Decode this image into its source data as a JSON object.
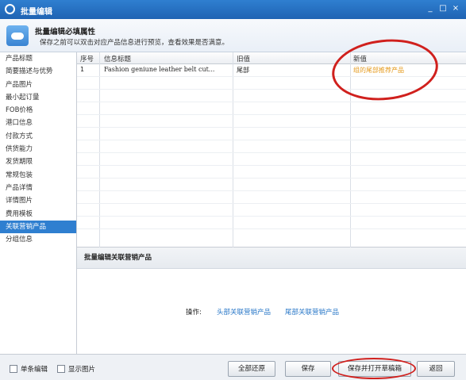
{
  "window": {
    "title": "批量编辑",
    "controls": [
      "_",
      "□",
      "×"
    ]
  },
  "header": {
    "title": "批量编辑必填属性",
    "subtitle": "保存之前可以双击对应产品信息进行预览，查看效果是否满意。"
  },
  "sidebar": {
    "items": [
      {
        "label": "产品标题",
        "active": false
      },
      {
        "label": "简要描述与优势",
        "active": false
      },
      {
        "label": "产品图片",
        "active": false
      },
      {
        "label": "最小起订量",
        "active": false
      },
      {
        "label": "FOB价格",
        "active": false
      },
      {
        "label": "港口信息",
        "active": false
      },
      {
        "label": "付款方式",
        "active": false
      },
      {
        "label": "供货能力",
        "active": false
      },
      {
        "label": "发货期限",
        "active": false
      },
      {
        "label": "常规包装",
        "active": false
      },
      {
        "label": "产品详情",
        "active": false
      },
      {
        "label": "详情图片",
        "active": false
      },
      {
        "label": "费用模板",
        "active": false
      },
      {
        "label": "关联营销产品",
        "active": true
      },
      {
        "label": "分组信息",
        "active": false
      }
    ]
  },
  "table": {
    "columns": [
      "序号",
      "信息标题",
      "旧值",
      "新值"
    ],
    "rows": [
      {
        "index": "1",
        "title": "Fashion geniune leather belt cut...",
        "old": "尾部",
        "new": "组的尾部推荐产品"
      }
    ]
  },
  "bulk_section": {
    "title": "批量编辑关联营销产品",
    "op_label": "操作:",
    "link_head": "头部关联营销产品",
    "link_tail": "尾部关联营销产品"
  },
  "footer": {
    "single_edit": "单条编辑",
    "show_images": "显示图片",
    "restore_all": "全部还原",
    "save": "保存",
    "save_and_open": "保存并打开草稿箱",
    "back": "返回"
  },
  "colors": {
    "titlebar": "#2f7fd0",
    "active_item": "#2f7fd0",
    "new_value": "#e59a1c",
    "link": "#2a78c8",
    "annotation": "#d0201d"
  }
}
